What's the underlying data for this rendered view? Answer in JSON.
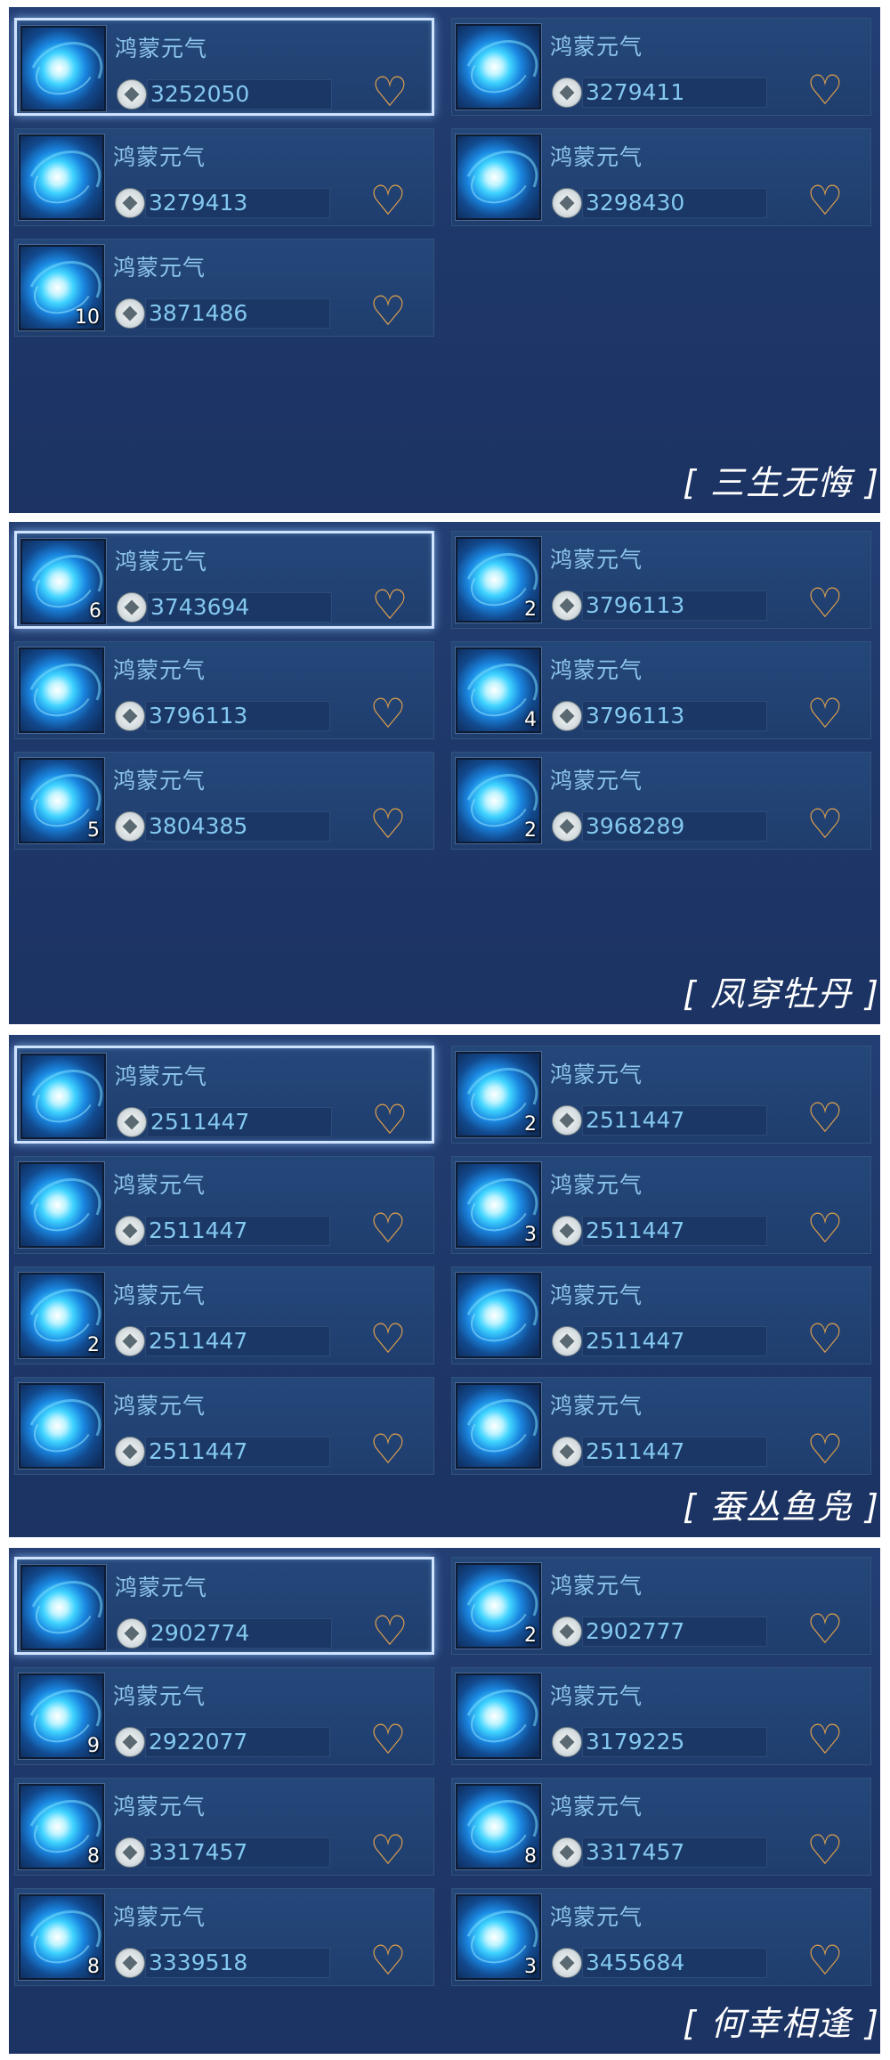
{
  "sections": [
    {
      "caption": "[ 三生无悔 ]",
      "items": [
        {
          "name": "鸿蒙元气",
          "price": "3252050",
          "count": "",
          "selected": true
        },
        {
          "name": "鸿蒙元气",
          "price": "3279411",
          "count": "",
          "selected": false
        },
        {
          "name": "鸿蒙元气",
          "price": "3279413",
          "count": "",
          "selected": false
        },
        {
          "name": "鸿蒙元气",
          "price": "3298430",
          "count": "",
          "selected": false
        },
        {
          "name": "鸿蒙元气",
          "price": "3871486",
          "count": "10",
          "selected": false
        }
      ]
    },
    {
      "caption": "[ 凤穿牡丹 ]",
      "items": [
        {
          "name": "鸿蒙元气",
          "price": "3743694",
          "count": "6",
          "selected": true
        },
        {
          "name": "鸿蒙元气",
          "price": "3796113",
          "count": "2",
          "selected": false
        },
        {
          "name": "鸿蒙元气",
          "price": "3796113",
          "count": "",
          "selected": false
        },
        {
          "name": "鸿蒙元气",
          "price": "3796113",
          "count": "4",
          "selected": false
        },
        {
          "name": "鸿蒙元气",
          "price": "3804385",
          "count": "5",
          "selected": false
        },
        {
          "name": "鸿蒙元气",
          "price": "3968289",
          "count": "2",
          "selected": false
        }
      ]
    },
    {
      "caption": "[ 蚕丛鱼凫 ]",
      "items": [
        {
          "name": "鸿蒙元气",
          "price": "2511447",
          "count": "",
          "selected": true
        },
        {
          "name": "鸿蒙元气",
          "price": "2511447",
          "count": "2",
          "selected": false
        },
        {
          "name": "鸿蒙元气",
          "price": "2511447",
          "count": "",
          "selected": false
        },
        {
          "name": "鸿蒙元气",
          "price": "2511447",
          "count": "3",
          "selected": false
        },
        {
          "name": "鸿蒙元气",
          "price": "2511447",
          "count": "2",
          "selected": false
        },
        {
          "name": "鸿蒙元气",
          "price": "2511447",
          "count": "",
          "selected": false
        },
        {
          "name": "鸿蒙元气",
          "price": "2511447",
          "count": "",
          "selected": false
        },
        {
          "name": "鸿蒙元气",
          "price": "2511447",
          "count": "",
          "selected": false
        }
      ]
    },
    {
      "caption": "[ 何幸相逢 ]",
      "items": [
        {
          "name": "鸿蒙元气",
          "price": "2902774",
          "count": "",
          "selected": true
        },
        {
          "name": "鸿蒙元气",
          "price": "2902777",
          "count": "2",
          "selected": false
        },
        {
          "name": "鸿蒙元气",
          "price": "2922077",
          "count": "9",
          "selected": false
        },
        {
          "name": "鸿蒙元气",
          "price": "3179225",
          "count": "",
          "selected": false
        },
        {
          "name": "鸿蒙元气",
          "price": "3317457",
          "count": "8",
          "selected": false
        },
        {
          "name": "鸿蒙元气",
          "price": "3317457",
          "count": "8",
          "selected": false
        },
        {
          "name": "鸿蒙元气",
          "price": "3339518",
          "count": "8",
          "selected": false
        },
        {
          "name": "鸿蒙元气",
          "price": "3455684",
          "count": "3",
          "selected": false
        }
      ]
    }
  ],
  "icons": {
    "item": "swirling-energy-orb-icon",
    "currency": "silver-coin-icon",
    "favorite": "heart-outline-icon"
  },
  "colors": {
    "panel_bg": "#1e3769",
    "item_bg": "#22426f",
    "name_text": "#8ec5ee",
    "price_text": "#84c8f0",
    "heart": "#e4a24b",
    "selected_border": "#cfe3ff"
  }
}
